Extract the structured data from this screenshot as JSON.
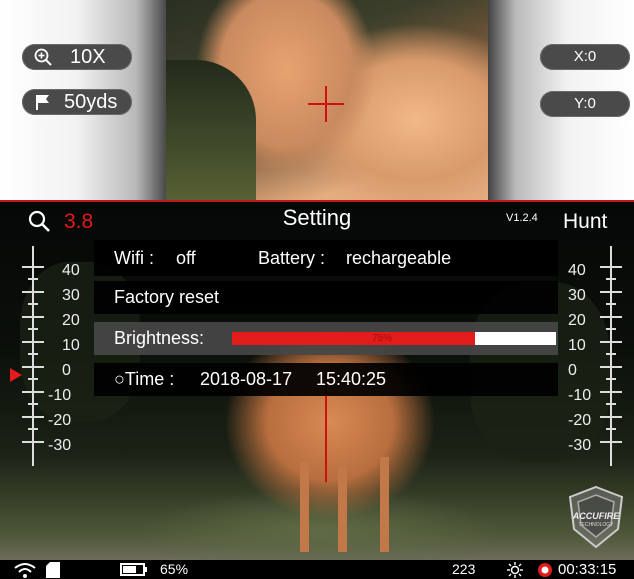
{
  "top_view": {
    "zoom_label": "10X",
    "range_label": "50yds",
    "x_label": "X:0",
    "y_label": "Y:0"
  },
  "header": {
    "magnification": "3.8",
    "title": "Setting",
    "version": "V1.2.4",
    "mode": "Hunt"
  },
  "left_scale": {
    "labels": [
      "40",
      "30",
      "20",
      "10",
      "0",
      "-10",
      "-20",
      "-30"
    ]
  },
  "right_scale": {
    "labels": [
      "40",
      "30",
      "20",
      "10",
      "0",
      "-10",
      "-20",
      "-30"
    ]
  },
  "menu": {
    "wifi_label": "Wifi :",
    "wifi_value": "off",
    "battery_label": "Battery :",
    "battery_value": "rechargeable",
    "factory_reset": "Factory reset",
    "brightness_label": "Brightness:",
    "brightness_value": 0.75,
    "brightness_text": "75%",
    "time_label": "○Time :",
    "time_date": "2018-08-17",
    "time_clock": "15:40:25"
  },
  "status_bar": {
    "battery_percent": "65%",
    "counter": "223",
    "rec_time": "00:33:15"
  },
  "logo": {
    "brand": "ACCUFIRE",
    "sub": "TECHNOLOGY"
  },
  "colors": {
    "accent_red": "#e21b1b",
    "menu_bg": "#000000",
    "selected_row": "#464646"
  },
  "icons": [
    "zoom-in-icon",
    "flag-icon",
    "search-icon",
    "wifi-icon",
    "sd-card-icon",
    "battery-icon",
    "brightness-sun-icon",
    "record-icon"
  ]
}
